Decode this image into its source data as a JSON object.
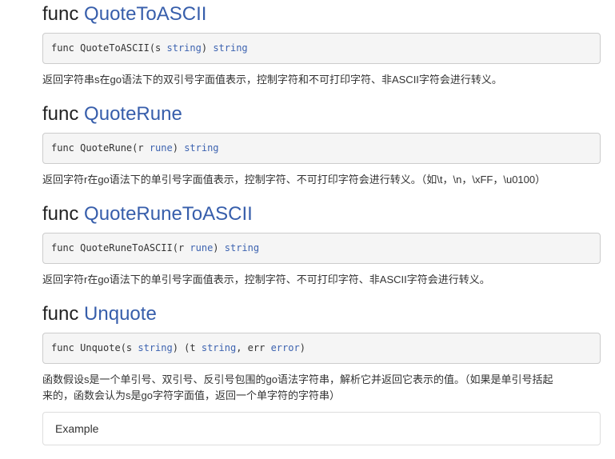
{
  "sections": [
    {
      "keyword": "func",
      "name": "QuoteToASCII",
      "signature": {
        "prefix": "func QuoteToASCII(s ",
        "param_type": "string",
        "mid": ") ",
        "return_type": "string"
      },
      "description": "返回字符串s在go语法下的双引号字面值表示，控制字符和不可打印字符、非ASCII字符会进行转义。"
    },
    {
      "keyword": "func",
      "name": "QuoteRune",
      "signature": {
        "prefix": "func QuoteRune(r ",
        "param_type": "rune",
        "mid": ") ",
        "return_type": "string"
      },
      "description": "返回字符r在go语法下的单引号字面值表示，控制字符、不可打印字符会进行转义。（如\\t，\\n，\\xFF，\\u0100）"
    },
    {
      "keyword": "func",
      "name": "QuoteRuneToASCII",
      "signature": {
        "prefix": "func QuoteRuneToASCII(r ",
        "param_type": "rune",
        "mid": ") ",
        "return_type": "string"
      },
      "description": "返回字符r在go语法下的单引号字面值表示，控制字符、不可打印字符、非ASCII字符会进行转义。"
    },
    {
      "keyword": "func",
      "name": "Unquote",
      "signature": {
        "prefix": "func Unquote(s ",
        "param_type": "string",
        "mid": ") (t ",
        "ret1_type": "string",
        "sep": ", err ",
        "ret2_type": "error",
        "end": ")"
      },
      "description_lines": [
        "函数假设s是一个单引号、双引号、反引号包围的go语法字符串，解析它并返回它表示的值。（如果是单引号括起",
        "来的，函数会认为s是go字符字面值，返回一个单字符的字符串）"
      ]
    }
  ],
  "example": {
    "label": "Example"
  },
  "colors": {
    "func_name": "#375eab",
    "type_keyword": "#3d63b0",
    "code_background": "#f5f5f5",
    "code_border": "#cccccc"
  }
}
